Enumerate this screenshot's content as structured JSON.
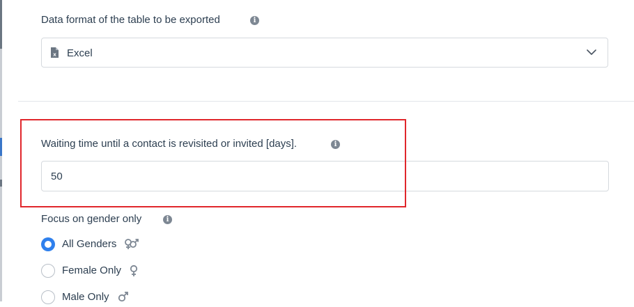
{
  "export_format": {
    "label": "Data format of the table to be exported",
    "info_icon": "info-icon",
    "selected_value": "Excel",
    "value_icon": "excel-file-icon",
    "dropdown_icon": "chevron-down-icon"
  },
  "waiting_time": {
    "label": "Waiting time until a contact is revisited or invited [days].",
    "info_icon": "info-icon",
    "value": "50",
    "highlight_color": "#e0262b"
  },
  "gender_focus": {
    "label": "Focus on gender only",
    "info_icon": "info-icon",
    "options": [
      {
        "label": "All Genders",
        "icon": "all-genders-icon",
        "checked": true
      },
      {
        "label": "Female Only",
        "icon": "female-icon",
        "checked": false
      },
      {
        "label": "Male Only",
        "icon": "male-icon",
        "checked": false
      }
    ],
    "accent_color": "#2f80ed"
  }
}
